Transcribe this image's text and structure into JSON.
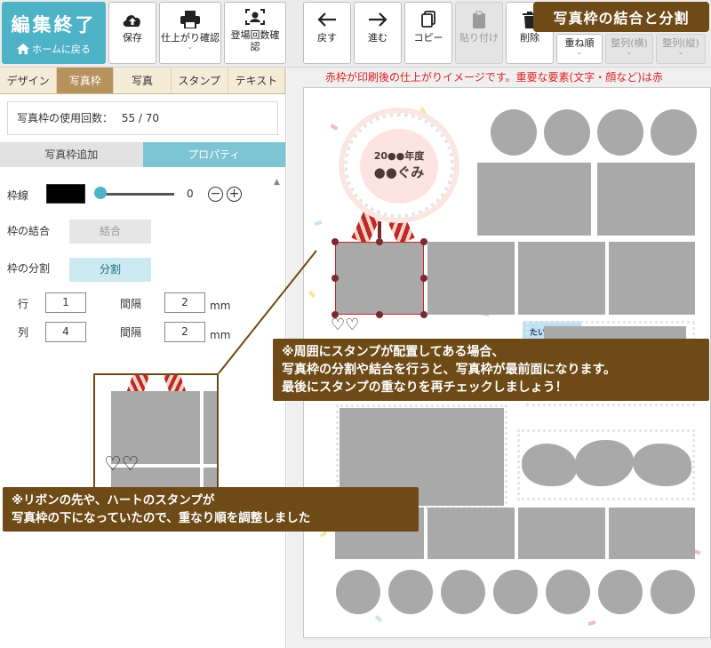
{
  "toolbar": {
    "finish_title": "編集終了",
    "home_label": "ホームに戻る",
    "save_label": "保存",
    "preview_label": "仕上がり確認",
    "appearance_label": "登場回数確認",
    "back_label": "戻す",
    "forward_label": "進む",
    "copy_label": "コピー",
    "paste_label": "貼り付け",
    "delete_label": "削除",
    "order_label": "重ね順",
    "align_h_label": "整列(横)",
    "align_v_label": "整列(縦)"
  },
  "banner": {
    "title": "写真枠の結合と分割"
  },
  "tabs": [
    {
      "label": "デザイン"
    },
    {
      "label": "写真枠"
    },
    {
      "label": "写真"
    },
    {
      "label": "スタンプ"
    },
    {
      "label": "テキスト"
    }
  ],
  "usage": {
    "label": "写真枠の使用回数：",
    "value": "55 / 70"
  },
  "subtabs": {
    "add": "写真枠追加",
    "property": "プロパティ"
  },
  "properties": {
    "border_label": "枠線",
    "border_color": "#000000",
    "border_value": "0",
    "merge_label": "枠の結合",
    "merge_button": "結合",
    "split_label": "枠の分割",
    "split_button": "分割",
    "row_label": "行",
    "row_value": "1",
    "col_label": "列",
    "col_value": "4",
    "gap_label": "間隔",
    "gap_row_value": "2",
    "gap_col_value": "2",
    "unit": "mm"
  },
  "canvas": {
    "notice": "赤枠が印刷後の仕上がりイメージです。重要な要素(文字・顔など)は赤",
    "badge_year": "20●●年度",
    "badge_class": "●●ぐみ",
    "label_tag": "たいそう"
  },
  "callouts": {
    "top": [
      "※周囲にスタンプが配置してある場合、",
      "写真枠の分割や結合を行うと、写真枠が最前面になります。",
      "最後にスタンプの重なりを再チェックしましょう！"
    ],
    "bottom": [
      "※リボンの先や、ハートのスタンプが",
      "写真枠の下になっていたので、重なり順を調整しました"
    ]
  },
  "colors": {
    "accent": "#4fb3c7",
    "brown": "#6e4a16",
    "tab_active": "#b7925c",
    "placeholder": "#a9a9a9",
    "selection": "#c0272d"
  }
}
